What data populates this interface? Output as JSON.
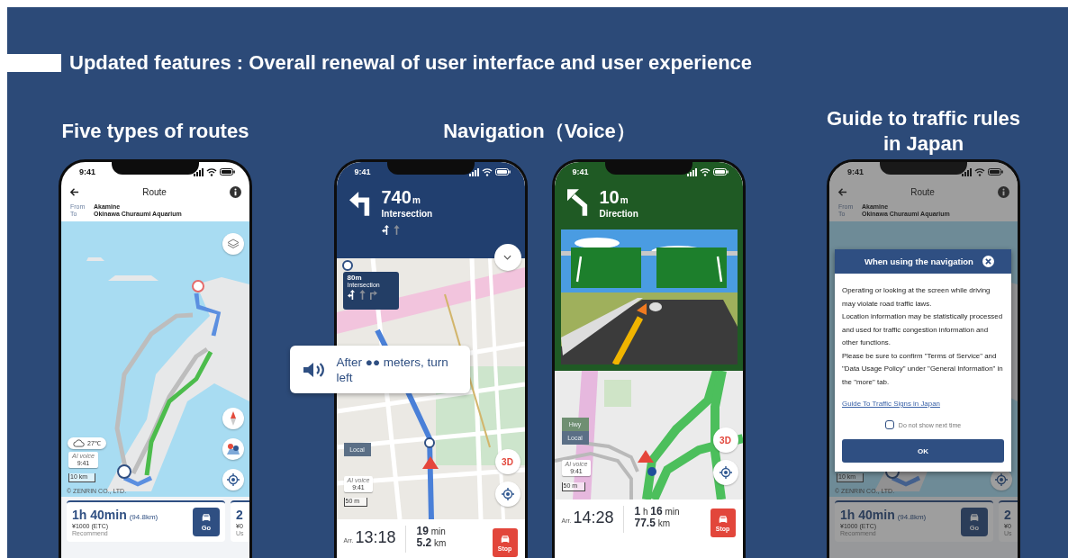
{
  "heading": "Updated features : Overall renewal of user interface and user experience",
  "sections": [
    {
      "title": "Five types of routes",
      "phones": [
        {
          "kind": "route",
          "time": "9:41",
          "title": "Route",
          "from_label": "From",
          "from": "Akamine",
          "to_label": "To",
          "to": "Okinawa Churaumi Aquarium",
          "map": {
            "kind": "island"
          },
          "controls": [
            {
              "kind": "layers"
            },
            {
              "kind": "compass"
            },
            {
              "kind": "route-map"
            },
            {
              "kind": "locate"
            }
          ],
          "weather": "27℃",
          "ai_voice": {
            "label": "AI voice",
            "time": "9:41"
          },
          "scale": "10 km",
          "copyright": "© ZENRIN CO., LTD.",
          "cards": [
            {
              "duration": "1h 40min",
              "distance": "(94.8km)",
              "fare": "¥1000 (ETC)",
              "note": "Recommend",
              "button": "Go"
            },
            {
              "duration": "2",
              "fare": "¥0",
              "note": "Us"
            }
          ]
        }
      ]
    },
    {
      "title": "Navigation（Voice）",
      "callout": "After ●● meters, turn left",
      "phones": [
        {
          "kind": "nav",
          "header": {
            "kind": "blue"
          },
          "time": "9:41",
          "arrow": {
            "kind": "left"
          },
          "distance": "740",
          "unit": "m",
          "maneuver": "Intersection",
          "lanes": [
            {
              "kind": "left-straight",
              "recommended": true
            },
            {
              "kind": "straight",
              "recommended": false
            }
          ],
          "map": {
            "kind": "city"
          },
          "collapse_button": true,
          "next": {
            "distance": "80m",
            "maneuver": "Intersection",
            "lanes": [
              {
                "kind": "left-straight",
                "recommended": true
              },
              {
                "kind": "straight",
                "recommended": false
              },
              {
                "kind": "right",
                "recommended": false
              }
            ]
          },
          "modes": [
            {
              "label": "Local",
              "selected": true
            }
          ],
          "ai_voice": {
            "label": "AI voice",
            "time": "9:41"
          },
          "scale": "50 m",
          "view_button": "3D",
          "arrival_label": "Arr.",
          "arrival": "13:18",
          "duration": "**19** min",
          "trip_distance": "**5.2** km",
          "stop": "Stop"
        },
        {
          "kind": "nav",
          "header": {
            "kind": "green"
          },
          "time": "9:41",
          "arrow": {
            "kind": "slight-left"
          },
          "distance": "10",
          "unit": "m",
          "maneuver": "Direction",
          "junction": {
            "kind": "picture"
          },
          "map": {
            "kind": "highway"
          },
          "modes": [
            {
              "label": "Hwy",
              "selected": false
            },
            {
              "label": "Local",
              "selected": true
            }
          ],
          "ai_voice": {
            "label": "AI voice",
            "time": "9:41"
          },
          "scale": "50 m",
          "view_button": "3D",
          "arrival_label": "Arr.",
          "arrival": "14:28",
          "duration": "**1** h **16** min",
          "trip_distance": "**77.5** km",
          "stop": "Stop"
        }
      ]
    },
    {
      "title": "Guide to traffic rules in Japan",
      "phones": [
        {
          "kind": "route",
          "time": "9:41",
          "title": "Route",
          "from_label": "From",
          "from": "Akamine",
          "to_label": "To",
          "to": "Okinawa Churaumi Aquarium",
          "map": {
            "kind": "island-south"
          },
          "controls": [
            {
              "kind": "locate"
            }
          ],
          "scale": "10 km",
          "copyright": "© ZENRIN CO., LTD.",
          "cards": [
            {
              "duration": "1h 40min",
              "distance": "(94.8km)",
              "fare": "¥1000 (ETC)",
              "note": "Recommend",
              "button": "Go"
            },
            {
              "duration": "2",
              "fare": "¥0",
              "note": "Us"
            }
          ],
          "dialog": {
            "title": "When using the navigation",
            "body": [
              "Operating or looking at the screen while driving may violate road traffic laws.",
              "Location information may be statistically processed and used for traffic congestion information and other functions.",
              "Please be sure to confirm \"Terms of Service\" and \"Data Usage Policy\" under \"General Information\" in the \"more\" tab."
            ],
            "link": "Guide To Traffic Signs in Japan",
            "checkbox": {
              "label": "Do not show next time",
              "checked": false
            },
            "button": "OK"
          }
        }
      ]
    }
  ]
}
